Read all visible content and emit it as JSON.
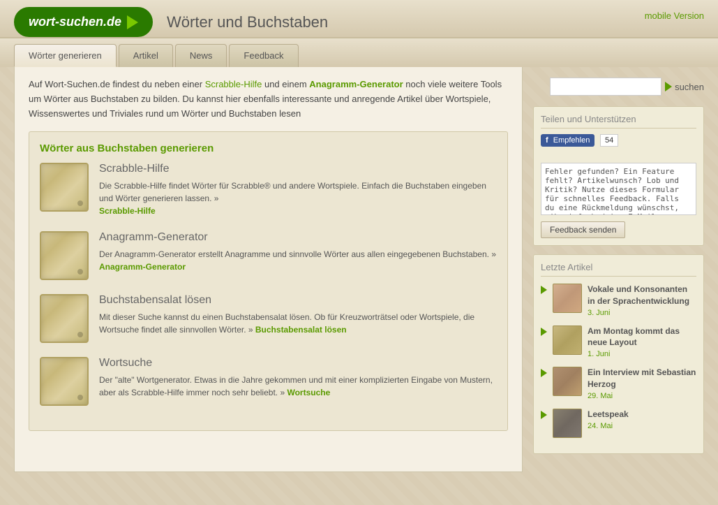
{
  "header": {
    "logo_text": "wort-suchen.de",
    "site_title": "Wörter und Buchstaben",
    "mobile_link": "mobile Version"
  },
  "nav": {
    "tabs": [
      {
        "label": "Wörter generieren",
        "active": true
      },
      {
        "label": "Artikel",
        "active": false
      },
      {
        "label": "News",
        "active": false
      },
      {
        "label": "Feedback",
        "active": false
      }
    ]
  },
  "search": {
    "placeholder": "",
    "button_label": "suchen"
  },
  "intro": {
    "text_before": "Auf Wort-Suchen.de findest du neben einer ",
    "link1": "Scrabble-Hilfe",
    "text_middle1": " und einem ",
    "link2": "Anagramm-Generator",
    "text_middle2": " noch viele weitere Tools um Wörter aus Buchstaben zu bilden. Du kannst hier ebenfalls interessante und anregende Artikel über Wortspiele, Wissenswertes und Triviales rund um Wörter und Buchstaben lesen"
  },
  "feature_box": {
    "title": "Wörter aus Buchstaben generieren",
    "items": [
      {
        "name": "scrabble",
        "heading": "Scrabble-Hilfe",
        "description": "Die Scrabble-Hilfe findet Wörter für Scrabble® und andere Wortspiele. Einfach die Buchstaben eingeben und Wörter generieren lassen. »",
        "link_text": "Scrabble-Hilfe"
      },
      {
        "name": "anagramm",
        "heading": "Anagramm-Generator",
        "description": "Der Anagramm-Generator erstellt Anagramme und sinnvolle Wörter aus allen eingegebenen Buchstaben. »",
        "link_text": "Anagramm-Generator"
      },
      {
        "name": "buchstabensalat",
        "heading": "Buchstabensalat lösen",
        "description": "Mit dieser Suche kannst du einen Buchstabensalat lösen. Ob für Kreuzworträtsel oder Wortspiele, die Wortsuche findet alle sinnvollen Wörter. »",
        "link_text": "Buchstabensalat lösen"
      },
      {
        "name": "wortsuche",
        "heading": "Wortsuche",
        "description": "Der \"alte\" Wortgenerator. Etwas in die Jahre gekommen und mit einer komplizierten Eingabe von Mustern, aber als Scrabble-Hilfe immer noch sehr beliebt. »",
        "link_text": "Wortsuche"
      }
    ]
  },
  "sidebar": {
    "share_title": "Teilen und Unterstützen",
    "fb_button": "f Empfehlen",
    "fb_count": "54",
    "feedback_placeholder": "Fehler gefunden? Ein Feature fehlt? Artikelwunsch? Lob und Kritik? Nutze dieses Formular für schnelles Feedback. Falls du eine Rückmeldung wünschst, gib einfach deine E-Mail-Adresse an.",
    "feedback_send": "Feedback senden",
    "articles_title": "Letzte Artikel",
    "articles": [
      {
        "title": "Vokale und Konsonanten in der Sprachentwicklung",
        "date": "3. Juni",
        "thumb_type": "face"
      },
      {
        "title": "Am Montag kommt das neue Layout",
        "date": "1. Juni",
        "thumb_type": "wood"
      },
      {
        "title": "Ein Interview mit Sebastian Herzog",
        "date": "29. Mai",
        "thumb_type": "face2"
      },
      {
        "title": "Leetspeak",
        "date": "24. Mai",
        "thumb_type": "dark"
      }
    ]
  }
}
